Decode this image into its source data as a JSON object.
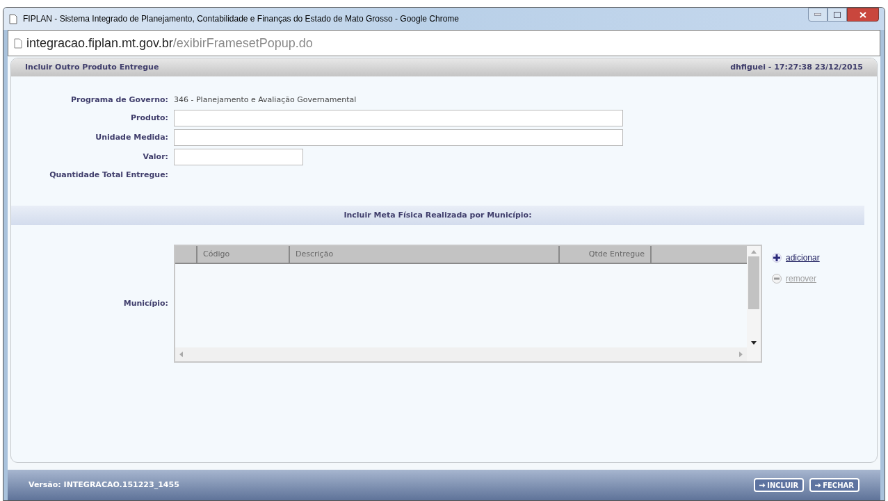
{
  "window": {
    "title": "FIPLAN - Sistema Integrado de Planejamento, Contabilidade e Finanças do Estado de Mato Grosso - Google Chrome"
  },
  "address_bar": {
    "host": "integracao.fiplan.mt.gov.br",
    "path": "/exibirFramesetPopup.do"
  },
  "panel": {
    "title": "Incluir Outro Produto Entregue",
    "user_info": "dhfiguei - 17:27:38 23/12/2015"
  },
  "form": [
    {
      "kind": "text",
      "label": "Programa de Governo:",
      "value": "346 - Planejamento e Avaliação Governamental"
    },
    {
      "kind": "wide_input",
      "label": "Produto:"
    },
    {
      "kind": "wide_input",
      "label": "Unidade Medida:"
    },
    {
      "kind": "short_input",
      "label": "Valor:"
    },
    {
      "kind": "text",
      "label": "Quantidade Total Entregue:"
    }
  ],
  "section": {
    "title": "Incluir Meta Física Realizada por Município:"
  },
  "municipio": {
    "label": "Município:",
    "columns": [
      "Código",
      "Descrição",
      "Qtde Entregue"
    ],
    "actions": [
      {
        "kind": "add",
        "label": "adicionar",
        "disabled": false
      },
      {
        "kind": "remove",
        "label": "remover",
        "disabled": true
      }
    ]
  },
  "footer": {
    "version": "Versão: INTEGRACAO.151223_1455",
    "buttons": [
      "INCLUIR",
      "FECHAR"
    ]
  }
}
